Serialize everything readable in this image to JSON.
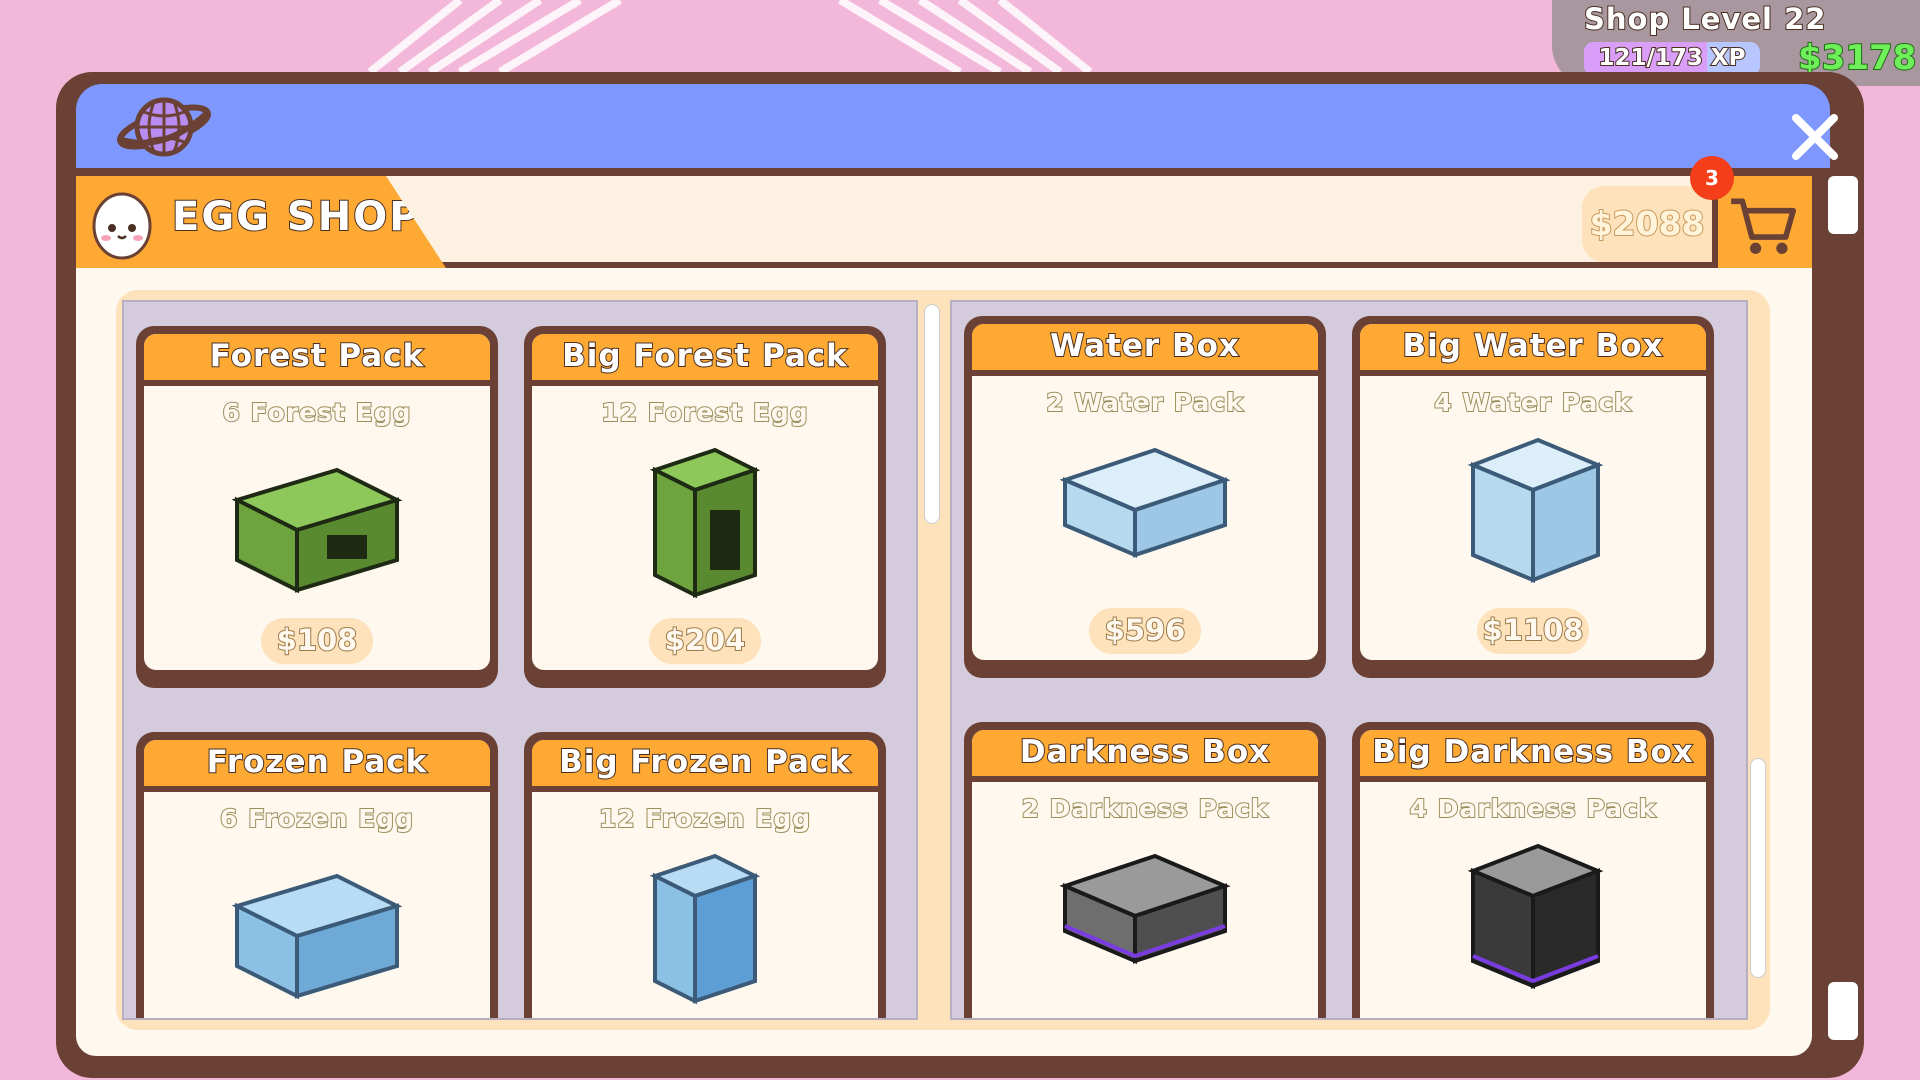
{
  "hud": {
    "shop_level": "Shop Level 22",
    "xp_text": "121/173 XP",
    "xp_fraction": 0.7,
    "cash": "$3178"
  },
  "window": {
    "title_icon": "globe-icon",
    "close_icon": "close-icon"
  },
  "shop": {
    "title": "EGG SHOP",
    "balance": "$2088",
    "cart_count": "3",
    "cart_icon": "cart-icon"
  },
  "colors": {
    "background": "#f2b7d9",
    "title_bar": "#7f98ff",
    "accent_orange": "#fda933",
    "frame_brown": "#6a4134",
    "cash_green": "#6ef05a",
    "badge_red": "#f43e1a"
  },
  "left_column": [
    {
      "title": "Forest Pack",
      "subtitle": "6 Forest Egg",
      "price": "$108",
      "image": "forest-crate"
    },
    {
      "title": "Big Forest Pack",
      "subtitle": "12 Forest Egg",
      "price": "$204",
      "image": "big-forest-crate"
    },
    {
      "title": "Frozen Pack",
      "subtitle": "6 Frozen Egg",
      "price": "",
      "image": "frozen-crate"
    },
    {
      "title": "Big Frozen Pack",
      "subtitle": "12 Frozen Egg",
      "price": "",
      "image": "big-frozen-crate"
    }
  ],
  "right_column": [
    {
      "title": "Water Box",
      "subtitle": "2 Water Pack",
      "price": "$596",
      "image": "water-crate"
    },
    {
      "title": "Big Water Box",
      "subtitle": "4 Water Pack",
      "price": "$1108",
      "image": "big-water-crate"
    },
    {
      "title": "Darkness Box",
      "subtitle": "2 Darkness Pack",
      "price": "",
      "image": "darkness-crate"
    },
    {
      "title": "Big Darkness Box",
      "subtitle": "4 Darkness Pack",
      "price": "",
      "image": "big-darkness-crate"
    }
  ]
}
